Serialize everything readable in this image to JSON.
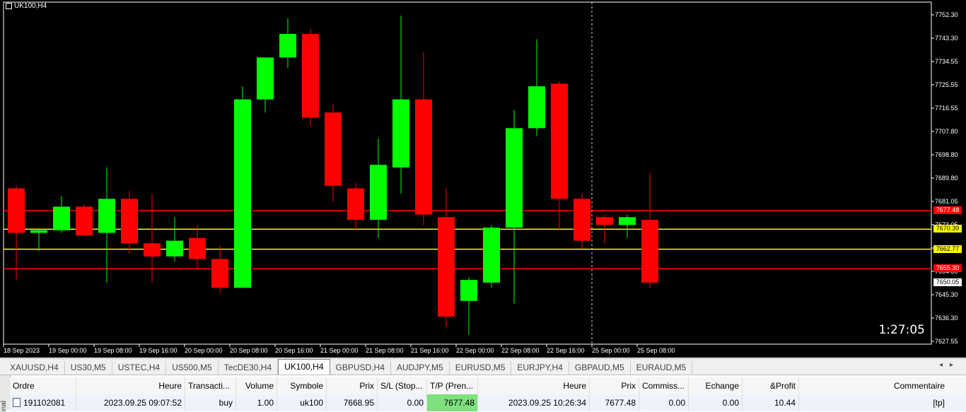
{
  "chart": {
    "symbol_title": "UK100,H4",
    "countdown": "1:27:05",
    "price_axis": [
      "7752.30",
      "7743.30",
      "7734.55",
      "7725.55",
      "7716.55",
      "7707.80",
      "7698.80",
      "7689.80",
      "7681.05",
      "7673.05",
      "7663.30",
      "7654.30",
      "7645.30",
      "7636.30",
      "7627.55"
    ],
    "time_axis": [
      "18 Sep 2023",
      "19 Sep 00:00",
      "19 Sep 08:00",
      "19 Sep 16:00",
      "20 Sep 00:00",
      "20 Sep 08:00",
      "20 Sep 16:00",
      "21 Sep 00:00",
      "21 Sep 08:00",
      "21 Sep 16:00",
      "22 Sep 00:00",
      "22 Sep 08:00",
      "22 Sep 16:00",
      "25 Sep 00:00",
      "25 Sep 08:00"
    ],
    "price_tags": [
      {
        "text": "7677.48",
        "bg": "#ff0000",
        "fg": "#ffffff",
        "price": 7677.48
      },
      {
        "text": "7670.39",
        "bg": "#ffff00",
        "fg": "#000000",
        "price": 7670.39
      },
      {
        "text": "7662.77",
        "bg": "#ffff00",
        "fg": "#000000",
        "price": 7662.77
      },
      {
        "text": "7655.30",
        "bg": "#ff0000",
        "fg": "#ffffff",
        "price": 7655.3
      },
      {
        "text": "7650.05",
        "bg": "#ffffff",
        "fg": "#000000",
        "price": 7650.05
      }
    ],
    "lines": [
      {
        "price": 7677.48,
        "color": "#ff0000"
      },
      {
        "price": 7670.39,
        "color": "#ffff00"
      },
      {
        "price": 7662.77,
        "color": "#ffff00"
      },
      {
        "price": 7655.3,
        "color": "#ff0000"
      }
    ],
    "colors": {
      "bull": "#00ff00",
      "bear": "#ff0000",
      "background": "#000000",
      "axis_text": "#ffffff"
    },
    "candles": [
      [
        7686.0,
        7687.0,
        7651.0,
        7669.0
      ],
      [
        7669.0,
        7670.8,
        7662.0,
        7670.0
      ],
      [
        7670.0,
        7683.0,
        7669.0,
        7679.0
      ],
      [
        7679.0,
        7680.0,
        7668.0,
        7668.0
      ],
      [
        7669.0,
        7694.0,
        7650.0,
        7682.0
      ],
      [
        7682.0,
        7685.0,
        7661.0,
        7665.0
      ],
      [
        7665.0,
        7684.0,
        7650.0,
        7660.0
      ],
      [
        7660.0,
        7675.0,
        7658.0,
        7666.0
      ],
      [
        7667.0,
        7672.0,
        7655.0,
        7659.0
      ],
      [
        7659.0,
        7664.0,
        7646.0,
        7648.0
      ],
      [
        7648.0,
        7725.0,
        7648.0,
        7720.0
      ],
      [
        7720.0,
        7736.0,
        7715.0,
        7736.0
      ],
      [
        7736.0,
        7751.0,
        7732.0,
        7745.0
      ],
      [
        7745.0,
        7747.0,
        7710.0,
        7713.0
      ],
      [
        7715.0,
        7718.0,
        7681.0,
        7687.0
      ],
      [
        7686.0,
        7688.0,
        7670.0,
        7674.0
      ],
      [
        7674.0,
        7705.0,
        7667.0,
        7695.0
      ],
      [
        7694.0,
        7752.0,
        7684.0,
        7720.0
      ],
      [
        7720.0,
        7738.0,
        7672.0,
        7676.0
      ],
      [
        7675.0,
        7686.0,
        7633.0,
        7637.0
      ],
      [
        7643.0,
        7652.0,
        7630.0,
        7651.0
      ],
      [
        7650.0,
        7672.0,
        7648.0,
        7671.0
      ],
      [
        7671.0,
        7716.0,
        7642.0,
        7709.0
      ],
      [
        7709.0,
        7743.0,
        7706.0,
        7725.0
      ],
      [
        7726.0,
        7727.0,
        7670.0,
        7682.0
      ],
      [
        7682.0,
        7684.0,
        7663.0,
        7666.0
      ],
      [
        7675.0,
        7676.0,
        7665.0,
        7672.0
      ],
      [
        7672.0,
        7676.0,
        7667.0,
        7675.0
      ],
      [
        7674.0,
        7692.0,
        7648.0,
        7650.0
      ]
    ]
  },
  "tabs": [
    {
      "label": "XAUUSD,H4",
      "active": false
    },
    {
      "label": "US30,M5",
      "active": false
    },
    {
      "label": "USTEC,H4",
      "active": false
    },
    {
      "label": "US500,M5",
      "active": false
    },
    {
      "label": "TecDE30,H4",
      "active": false
    },
    {
      "label": "UK100,H4",
      "active": true
    },
    {
      "label": "GBPUSD,H4",
      "active": false
    },
    {
      "label": "AUDJPY,M5",
      "active": false
    },
    {
      "label": "EURUSD,M5",
      "active": false
    },
    {
      "label": "EURJPY,H4",
      "active": false
    },
    {
      "label": "GBPAUD,M5",
      "active": false
    },
    {
      "label": "EURAUD,M5",
      "active": false
    }
  ],
  "terminal": {
    "side_label": "inal",
    "headers": [
      "Ordre",
      "Heure",
      "Transacti...",
      "Volume",
      "Symbole",
      "Prix",
      "S/L (Stop...",
      "T/P (Pren...",
      "Heure",
      "Prix",
      "Commiss...",
      "Echange",
      "&Profit",
      "Commentaire"
    ],
    "row": [
      "191102081",
      "2023.09.25 09:07:52",
      "buy",
      "1.00",
      "uk100",
      "7668.95",
      "0.00",
      "7677.48",
      "2023.09.25 10:26:34",
      "7677.48",
      "0.00",
      "0.00",
      "10.44",
      "[tp]"
    ]
  }
}
